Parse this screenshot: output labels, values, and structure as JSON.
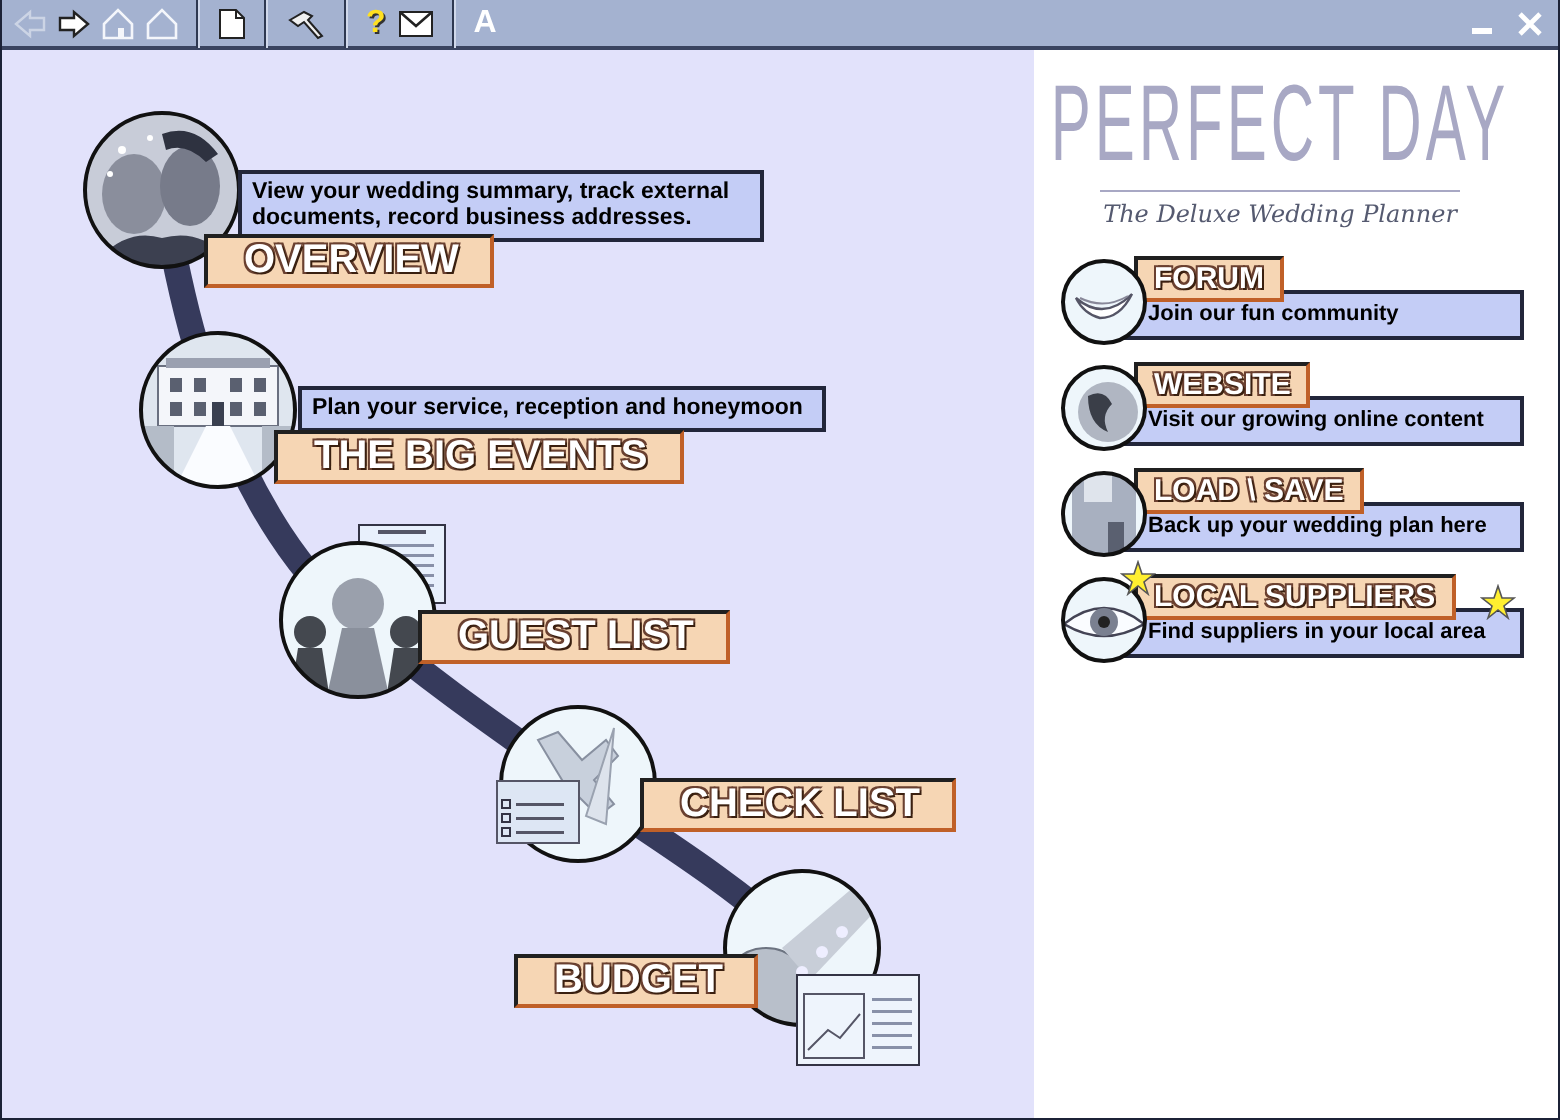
{
  "toolbar": [
    {
      "kind": "back",
      "disabled": true
    },
    {
      "kind": "forward",
      "disabled": false
    },
    {
      "kind": "home-alt"
    },
    {
      "kind": "home"
    },
    {
      "kind": "document"
    },
    {
      "kind": "hammer"
    },
    {
      "kind": "help",
      "glyph": "?"
    },
    {
      "kind": "mail"
    },
    {
      "kind": "font",
      "glyph": "A"
    }
  ],
  "window_controls": [
    {
      "kind": "minimize"
    },
    {
      "kind": "close"
    }
  ],
  "steps": [
    {
      "kind": "couple",
      "title": "OVERVIEW",
      "description": "View your wedding summary, track external documents, record business addresses."
    },
    {
      "kind": "building",
      "title": "THE BIG EVENTS",
      "description": "Plan your service, reception and honeymoon"
    },
    {
      "kind": "pawns",
      "title": "GUEST LIST"
    },
    {
      "kind": "check",
      "title": "CHECK LIST"
    },
    {
      "kind": "coin",
      "title": "BUDGET"
    }
  ],
  "brand": {
    "title": "PERFECT DAY",
    "tagline": "The Deluxe Wedding Planner"
  },
  "links": [
    {
      "kind": "smile",
      "title": "FORUM",
      "description": "Join our fun community",
      "starred": false
    },
    {
      "kind": "globe",
      "title": "WEBSITE",
      "description": "Visit our growing online content",
      "starred": false
    },
    {
      "kind": "floppy",
      "title": "LOAD \\ SAVE",
      "description": "Back up your wedding plan here",
      "starred": false
    },
    {
      "kind": "eye",
      "title": "LOCAL SUPPLIERS",
      "description": "Find suppliers in your local area",
      "starred": true
    }
  ]
}
